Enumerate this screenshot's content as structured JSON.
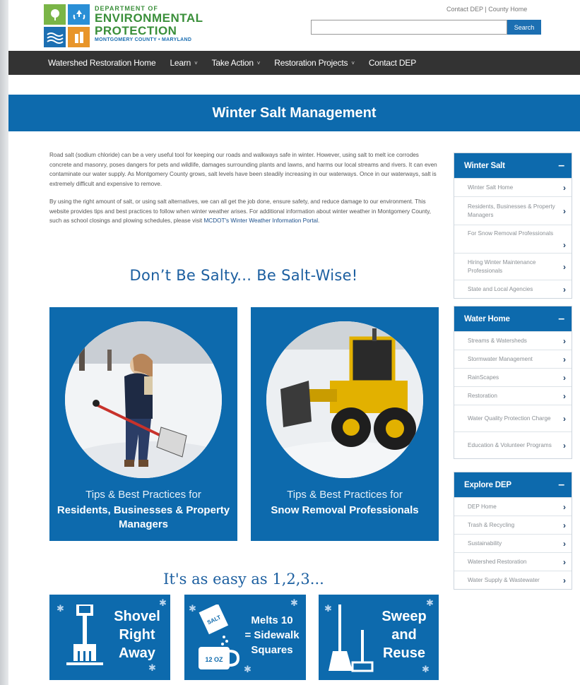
{
  "header": {
    "logo": {
      "line1": "DEPARTMENT OF",
      "line2": "ENVIRONMENTAL",
      "line3": "PROTECTION",
      "line4": "MONTGOMERY COUNTY • MARYLAND"
    },
    "util_links": "Contact DEP | County Home",
    "search": {
      "placeholder": "",
      "button": "Search"
    }
  },
  "nav": {
    "items": [
      {
        "label": "Watershed Restoration Home",
        "has_chevron": false
      },
      {
        "label": "Learn",
        "has_chevron": true
      },
      {
        "label": "Take Action",
        "has_chevron": true
      },
      {
        "label": "Restoration Projects",
        "has_chevron": true
      },
      {
        "label": "Contact DEP",
        "has_chevron": false
      }
    ],
    "chevron": "˅"
  },
  "banner": {
    "title": "Winter Salt Management"
  },
  "intro": {
    "p1": "Road salt (sodium chloride) can be a very useful tool for keeping our roads and walkways safe in winter. However, using salt to melt ice corrodes concrete and masonry, poses dangers for pets and wildlife, damages surrounding plants and lawns, and harms our local streams and rivers. It can even contaminate our water supply. As Montgomery County grows, salt levels have been steadily increasing in our waterways. Once in our waterways, salt is extremely difficult and expensive to remove.",
    "p2_text": "By using the right amount of salt, or using salt alternatives, we can all get the job done, ensure safety, and reduce damage to our environment. This website provides tips and best practices to follow when winter weather arises. For additional information about winter weather in Montgomery County, such as school closings and plowing schedules, please visit ",
    "p2_link": "MCDOT's Winter Weather Information Portal",
    "p2_end": "."
  },
  "tagline": "Don’t Be Salty... Be Salt-Wise!",
  "cards": [
    {
      "line1": "Tips & Best Practices for",
      "line2": "Residents, Businesses & Property Managers"
    },
    {
      "line1": "Tips & Best Practices for",
      "line2": "Snow Removal Professionals"
    }
  ],
  "easy_heading": "It's as easy as 1,2,3...",
  "steps": [
    {
      "text": [
        "Shovel",
        "Right",
        "Away"
      ],
      "icon": "shovel-icon"
    },
    {
      "text": [
        "Melts 10",
        "= Sidewalk",
        "Squares"
      ],
      "icon": "salt-mug-icon",
      "mug_label": "12 OZ",
      "bag_label": "SALT"
    },
    {
      "text": [
        "Sweep",
        "and",
        "Reuse"
      ],
      "icon": "broom-icon"
    }
  ],
  "sidebar": {
    "arrow": "›",
    "minus": "–",
    "boxes": [
      {
        "title": "Winter Salt",
        "items": [
          "Winter Salt Home",
          "Residents, Businesses & Property Managers",
          "For Snow Removal Professionals",
          "Hiring Winter Maintenance Professionals",
          "State and Local Agencies"
        ]
      },
      {
        "title": "Water Home",
        "items": [
          "Streams & Watersheds",
          "Stormwater Management",
          "RainScapes",
          "Restoration",
          "Water Quality Protection Charge",
          "Education & Volunteer Programs"
        ]
      },
      {
        "title": "Explore DEP",
        "items": [
          "DEP Home",
          "Trash & Recycling",
          "Sustainability",
          "Watershed Restoration",
          "Water Supply & Wastewater"
        ]
      }
    ]
  },
  "colors": {
    "primary_blue": "#0d6aad",
    "nav_bg": "#333333",
    "logo_green": "#3a8f3a",
    "heading_blue": "#1c5fa0"
  }
}
